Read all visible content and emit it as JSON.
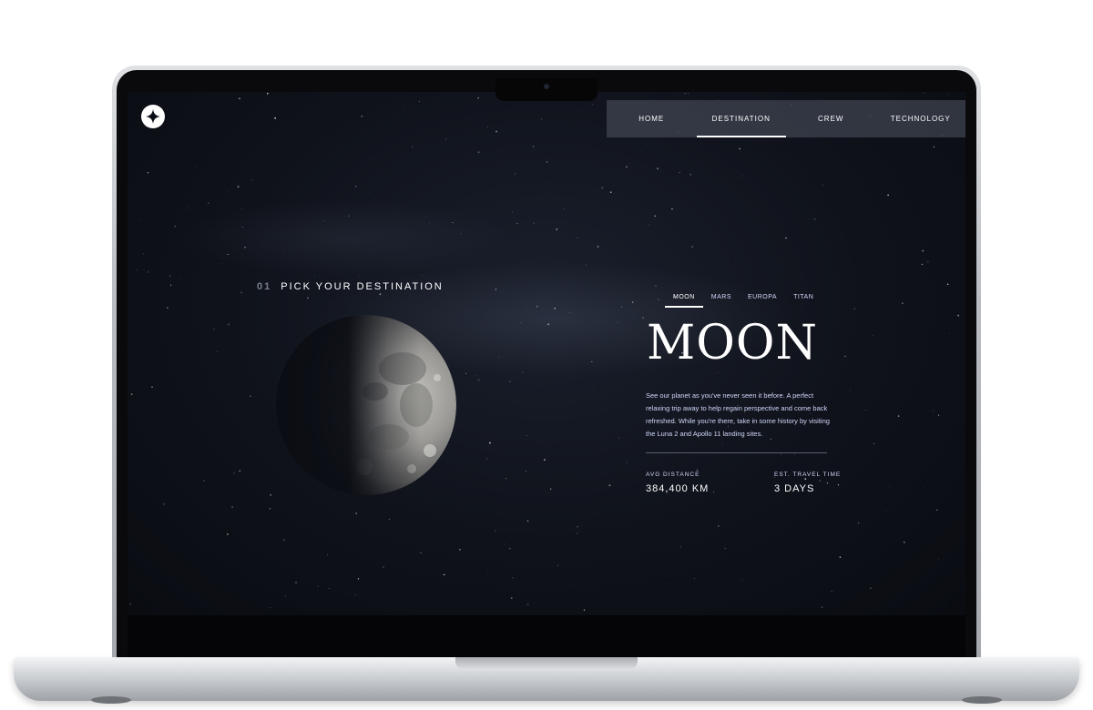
{
  "nav": {
    "items": [
      {
        "label": "HOME",
        "active": false
      },
      {
        "label": "DESTINATION",
        "active": true
      },
      {
        "label": "CREW",
        "active": false
      },
      {
        "label": "TECHNOLOGY",
        "active": false
      }
    ]
  },
  "logo": {
    "icon": "star-logo-icon"
  },
  "page": {
    "number": "01",
    "heading": "PICK YOUR DESTINATION"
  },
  "tabs": [
    {
      "label": "MOON",
      "active": true
    },
    {
      "label": "MARS",
      "active": false
    },
    {
      "label": "EUROPA",
      "active": false
    },
    {
      "label": "TITAN",
      "active": false
    }
  ],
  "destination": {
    "name": "MOON",
    "description": "See our planet as you've never seen it before. A perfect relaxing trip away to help regain perspective and come back refreshed. While you're there, take in some history by visiting the Luna 2 and Apollo 11 landing sites.",
    "stats": [
      {
        "label": "AVG DISTANCE",
        "value": "384,400 KM"
      },
      {
        "label": "EST. TRAVEL TIME",
        "value": "3 DAYS"
      }
    ]
  },
  "colors": {
    "background": "#0b0d17",
    "accent_text": "#d0d6f9",
    "text": "#ffffff"
  }
}
